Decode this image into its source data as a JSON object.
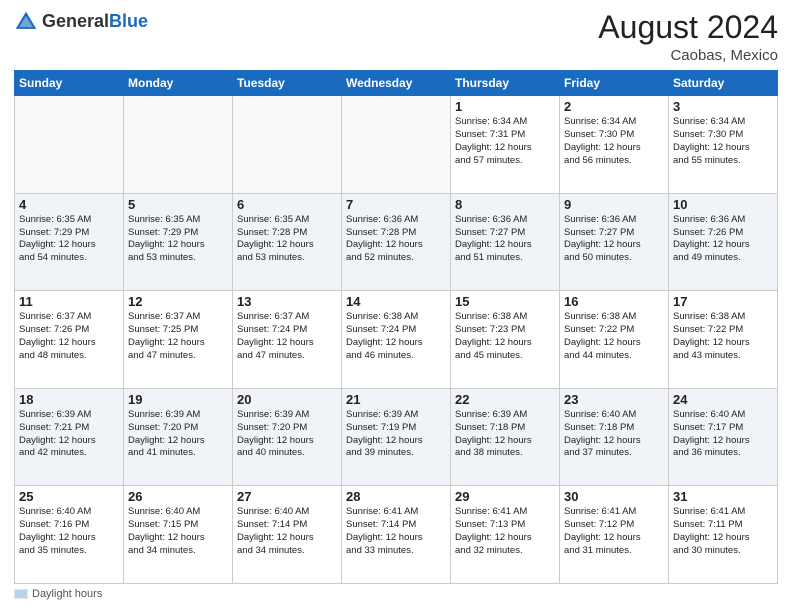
{
  "header": {
    "logo_general": "General",
    "logo_blue": "Blue",
    "month_year": "August 2024",
    "location": "Caobas, Mexico"
  },
  "calendar": {
    "days_of_week": [
      "Sunday",
      "Monday",
      "Tuesday",
      "Wednesday",
      "Thursday",
      "Friday",
      "Saturday"
    ],
    "weeks": [
      [
        {
          "day": "",
          "info": ""
        },
        {
          "day": "",
          "info": ""
        },
        {
          "day": "",
          "info": ""
        },
        {
          "day": "",
          "info": ""
        },
        {
          "day": "1",
          "info": "Sunrise: 6:34 AM\nSunset: 7:31 PM\nDaylight: 12 hours\nand 57 minutes."
        },
        {
          "day": "2",
          "info": "Sunrise: 6:34 AM\nSunset: 7:30 PM\nDaylight: 12 hours\nand 56 minutes."
        },
        {
          "day": "3",
          "info": "Sunrise: 6:34 AM\nSunset: 7:30 PM\nDaylight: 12 hours\nand 55 minutes."
        }
      ],
      [
        {
          "day": "4",
          "info": "Sunrise: 6:35 AM\nSunset: 7:29 PM\nDaylight: 12 hours\nand 54 minutes."
        },
        {
          "day": "5",
          "info": "Sunrise: 6:35 AM\nSunset: 7:29 PM\nDaylight: 12 hours\nand 53 minutes."
        },
        {
          "day": "6",
          "info": "Sunrise: 6:35 AM\nSunset: 7:28 PM\nDaylight: 12 hours\nand 53 minutes."
        },
        {
          "day": "7",
          "info": "Sunrise: 6:36 AM\nSunset: 7:28 PM\nDaylight: 12 hours\nand 52 minutes."
        },
        {
          "day": "8",
          "info": "Sunrise: 6:36 AM\nSunset: 7:27 PM\nDaylight: 12 hours\nand 51 minutes."
        },
        {
          "day": "9",
          "info": "Sunrise: 6:36 AM\nSunset: 7:27 PM\nDaylight: 12 hours\nand 50 minutes."
        },
        {
          "day": "10",
          "info": "Sunrise: 6:36 AM\nSunset: 7:26 PM\nDaylight: 12 hours\nand 49 minutes."
        }
      ],
      [
        {
          "day": "11",
          "info": "Sunrise: 6:37 AM\nSunset: 7:26 PM\nDaylight: 12 hours\nand 48 minutes."
        },
        {
          "day": "12",
          "info": "Sunrise: 6:37 AM\nSunset: 7:25 PM\nDaylight: 12 hours\nand 47 minutes."
        },
        {
          "day": "13",
          "info": "Sunrise: 6:37 AM\nSunset: 7:24 PM\nDaylight: 12 hours\nand 47 minutes."
        },
        {
          "day": "14",
          "info": "Sunrise: 6:38 AM\nSunset: 7:24 PM\nDaylight: 12 hours\nand 46 minutes."
        },
        {
          "day": "15",
          "info": "Sunrise: 6:38 AM\nSunset: 7:23 PM\nDaylight: 12 hours\nand 45 minutes."
        },
        {
          "day": "16",
          "info": "Sunrise: 6:38 AM\nSunset: 7:22 PM\nDaylight: 12 hours\nand 44 minutes."
        },
        {
          "day": "17",
          "info": "Sunrise: 6:38 AM\nSunset: 7:22 PM\nDaylight: 12 hours\nand 43 minutes."
        }
      ],
      [
        {
          "day": "18",
          "info": "Sunrise: 6:39 AM\nSunset: 7:21 PM\nDaylight: 12 hours\nand 42 minutes."
        },
        {
          "day": "19",
          "info": "Sunrise: 6:39 AM\nSunset: 7:20 PM\nDaylight: 12 hours\nand 41 minutes."
        },
        {
          "day": "20",
          "info": "Sunrise: 6:39 AM\nSunset: 7:20 PM\nDaylight: 12 hours\nand 40 minutes."
        },
        {
          "day": "21",
          "info": "Sunrise: 6:39 AM\nSunset: 7:19 PM\nDaylight: 12 hours\nand 39 minutes."
        },
        {
          "day": "22",
          "info": "Sunrise: 6:39 AM\nSunset: 7:18 PM\nDaylight: 12 hours\nand 38 minutes."
        },
        {
          "day": "23",
          "info": "Sunrise: 6:40 AM\nSunset: 7:18 PM\nDaylight: 12 hours\nand 37 minutes."
        },
        {
          "day": "24",
          "info": "Sunrise: 6:40 AM\nSunset: 7:17 PM\nDaylight: 12 hours\nand 36 minutes."
        }
      ],
      [
        {
          "day": "25",
          "info": "Sunrise: 6:40 AM\nSunset: 7:16 PM\nDaylight: 12 hours\nand 35 minutes."
        },
        {
          "day": "26",
          "info": "Sunrise: 6:40 AM\nSunset: 7:15 PM\nDaylight: 12 hours\nand 34 minutes."
        },
        {
          "day": "27",
          "info": "Sunrise: 6:40 AM\nSunset: 7:14 PM\nDaylight: 12 hours\nand 34 minutes."
        },
        {
          "day": "28",
          "info": "Sunrise: 6:41 AM\nSunset: 7:14 PM\nDaylight: 12 hours\nand 33 minutes."
        },
        {
          "day": "29",
          "info": "Sunrise: 6:41 AM\nSunset: 7:13 PM\nDaylight: 12 hours\nand 32 minutes."
        },
        {
          "day": "30",
          "info": "Sunrise: 6:41 AM\nSunset: 7:12 PM\nDaylight: 12 hours\nand 31 minutes."
        },
        {
          "day": "31",
          "info": "Sunrise: 6:41 AM\nSunset: 7:11 PM\nDaylight: 12 hours\nand 30 minutes."
        }
      ]
    ]
  },
  "footer": {
    "label": "Daylight hours"
  }
}
